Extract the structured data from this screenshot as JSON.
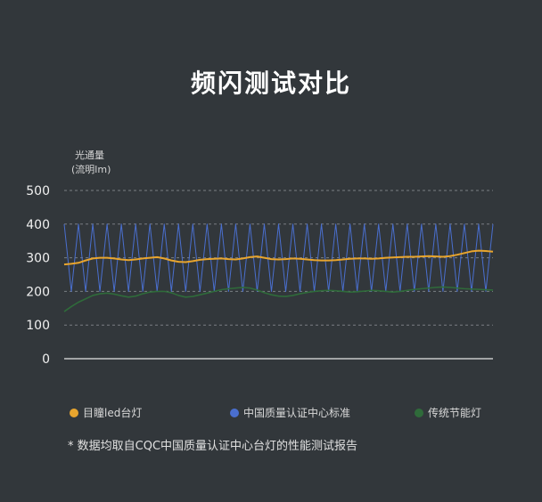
{
  "page": {
    "title": "频闪测试对比"
  },
  "chart_data": {
    "type": "line",
    "title": "频闪测试对比",
    "ylabel_line1": "光通量",
    "ylabel_line2": "(流明lm)",
    "xlabel": "",
    "ylim": [
      0,
      500
    ],
    "yticks": [
      0,
      100,
      200,
      300,
      400,
      500
    ],
    "grid": true,
    "legend_placement": "bottom",
    "x": [
      0,
      1,
      2,
      3,
      4,
      5,
      6,
      7,
      8,
      9,
      10,
      11,
      12,
      13,
      14,
      15,
      16,
      17,
      18,
      19,
      20,
      21,
      22,
      23,
      24,
      25,
      26,
      27,
      28,
      29,
      30,
      31,
      32,
      33,
      34,
      35,
      36,
      37,
      38,
      39,
      40,
      41,
      42,
      43,
      44,
      45,
      46,
      47,
      48,
      49,
      50,
      51,
      52,
      53,
      54,
      55,
      56,
      57,
      58,
      59,
      60
    ],
    "series": [
      {
        "name": "目瞳led台灯",
        "color": "#e8a52e",
        "values": [
          280,
          282,
          285,
          292,
          298,
          300,
          300,
          298,
          295,
          293,
          295,
          298,
          300,
          302,
          298,
          292,
          288,
          287,
          290,
          294,
          296,
          297,
          298,
          296,
          295,
          298,
          302,
          304,
          300,
          296,
          295,
          296,
          298,
          297,
          295,
          293,
          292,
          292,
          293,
          295,
          297,
          298,
          298,
          297,
          298,
          300,
          301,
          302,
          303,
          303,
          304,
          305,
          304,
          303,
          305,
          309,
          314,
          319,
          321,
          320,
          318
        ]
      },
      {
        "name": "中国质量认证中心标准",
        "color": "#4a6fcf",
        "values": [
          400,
          200,
          400,
          200,
          400,
          200,
          400,
          200,
          400,
          200,
          400,
          200,
          400,
          200,
          400,
          200,
          400,
          200,
          400,
          200,
          400,
          200,
          400,
          200,
          400,
          200,
          400,
          200,
          400,
          200,
          400,
          200,
          400,
          200,
          400,
          200,
          400,
          200,
          400,
          200,
          400,
          200,
          400,
          200,
          400,
          200,
          400,
          200,
          400,
          200,
          400,
          200,
          400,
          200,
          400,
          200,
          400,
          200,
          400,
          200,
          400
        ]
      },
      {
        "name": "传统节能灯",
        "color": "#2f6b3a",
        "values": [
          140,
          155,
          168,
          178,
          188,
          193,
          195,
          192,
          187,
          183,
          186,
          193,
          198,
          200,
          200,
          196,
          188,
          183,
          185,
          190,
          195,
          200,
          205,
          208,
          210,
          212,
          210,
          204,
          196,
          190,
          186,
          185,
          188,
          193,
          197,
          200,
          202,
          203,
          202,
          200,
          198,
          199,
          201,
          203,
          202,
          200,
          198,
          200,
          203,
          206,
          208,
          210,
          212,
          213,
          212,
          210,
          208,
          207,
          206,
          205,
          204
        ]
      }
    ]
  },
  "legend": [
    {
      "label": "目瞳led台灯",
      "color": "#e8a52e"
    },
    {
      "label": "中国质量认证中心标准",
      "color": "#4a6fcf"
    },
    {
      "label": "传统节能灯",
      "color": "#2f6b3a"
    }
  ],
  "footnote": "* 数据均取自CQC中国质量认证中心台灯的性能测试报告"
}
